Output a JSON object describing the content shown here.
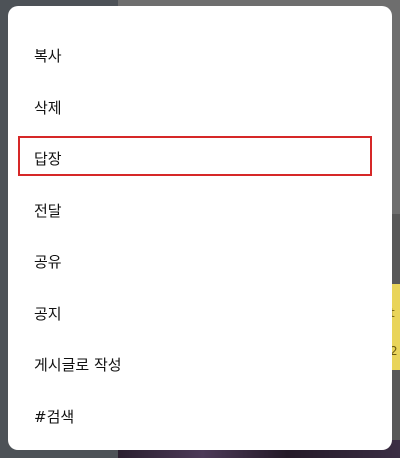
{
  "background": {
    "partial_chars": [
      "t",
      "2"
    ]
  },
  "menu": {
    "items": [
      {
        "label": "복사",
        "highlighted": false
      },
      {
        "label": "삭제",
        "highlighted": false
      },
      {
        "label": "답장",
        "highlighted": true
      },
      {
        "label": "전달",
        "highlighted": false
      },
      {
        "label": "공유",
        "highlighted": false
      },
      {
        "label": "공지",
        "highlighted": false
      },
      {
        "label": "게시글로 작성",
        "highlighted": false
      },
      {
        "label": "#검색",
        "highlighted": false
      }
    ]
  },
  "colors": {
    "highlight_border": "#d62828",
    "menu_background": "#ffffff",
    "dim_background": "#4d5257"
  }
}
